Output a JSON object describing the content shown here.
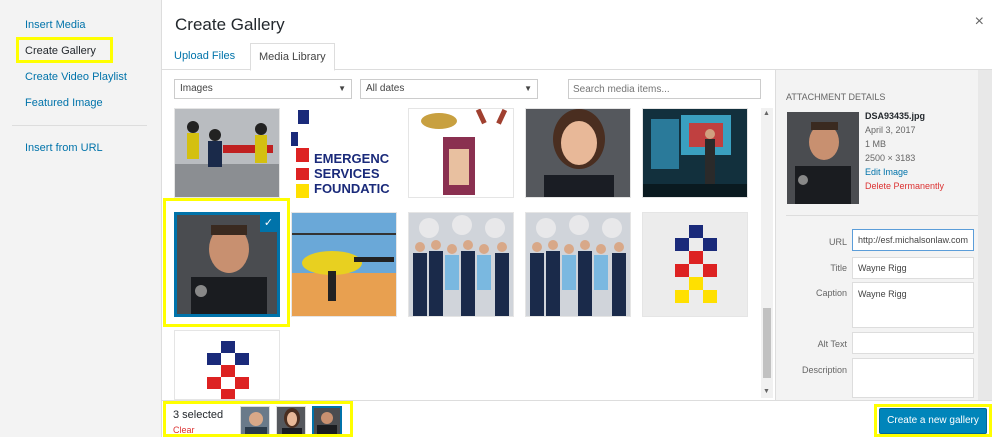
{
  "sidebar": {
    "items": [
      {
        "label": "Insert Media"
      },
      {
        "label": "Create Gallery"
      },
      {
        "label": "Create Video Playlist"
      },
      {
        "label": "Featured Image"
      },
      {
        "label": "Insert from URL"
      }
    ]
  },
  "frame": {
    "title": "Create Gallery",
    "close": "×"
  },
  "tabs": [
    {
      "label": "Upload Files"
    },
    {
      "label": "Media Library"
    }
  ],
  "filters": {
    "type": "Images",
    "date": "All dates",
    "search_placeholder": "Search media items..."
  },
  "grid": {
    "logo_text_lines": [
      "EMERGENC",
      "SERVICES",
      "FOUNDATIC"
    ]
  },
  "details": {
    "heading": "ATTACHMENT DETAILS",
    "filename": "DSA93435.jpg",
    "date": "April 3, 2017",
    "size": "1 MB",
    "dimensions": "2500 × 3183",
    "edit_link": "Edit Image",
    "delete_link": "Delete Permanently",
    "url_label": "URL",
    "url_value": "http://esf.michalsonlaw.com",
    "title_label": "Title",
    "title_value": "Wayne Rigg",
    "caption_label": "Caption",
    "caption_value": "Wayne Rigg",
    "alt_label": "Alt Text",
    "alt_value": "",
    "desc_label": "Description",
    "desc_value": ""
  },
  "toolbar": {
    "selected_count": "3 selected",
    "clear": "Clear",
    "create_button": "Create a new gallery"
  },
  "colors": {
    "accent": "#0073aa",
    "button": "#0085ba",
    "highlight": "#ffff00",
    "danger": "#dc3232"
  }
}
